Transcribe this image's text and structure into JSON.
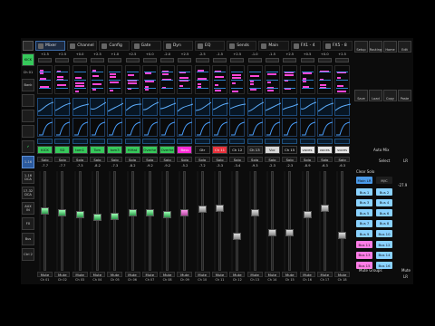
{
  "tabs": [
    {
      "label": "Mixer",
      "icon": "mixer-icon",
      "active": true
    },
    {
      "label": "Channel",
      "icon": "channel-icon"
    },
    {
      "label": "Config",
      "icon": "config-icon"
    },
    {
      "label": "Gate",
      "icon": "gate-icon"
    },
    {
      "label": "Dyn",
      "icon": "dyn-icon"
    },
    {
      "label": "EQ",
      "icon": "eq-icon"
    },
    {
      "label": "Sends",
      "icon": "sends-icon"
    },
    {
      "label": "Main",
      "icon": "main-icon"
    },
    {
      "label": "FX1 - 4",
      "icon": "fx-icon"
    },
    {
      "label": "FX5 - 8",
      "icon": "fx-icon"
    }
  ],
  "left": {
    "kick": "KICK",
    "ch": "Ch 01",
    "bank": "Bank",
    "buttons": [
      "",
      "",
      "",
      ""
    ],
    "layers": [
      "1-16",
      "1-16\nDCA",
      "17-32\nDCA",
      "AUX\nIN",
      "FX",
      "Bus",
      "Ctrl 2"
    ]
  },
  "channels": [
    {
      "name": "KICK",
      "gain": "+2.5",
      "db": "-7.7",
      "ch": "Ch 01",
      "color": "#36c95b",
      "fader": 0.62
    },
    {
      "name": "SD",
      "gain": "+2.5",
      "db": "-7.7",
      "ch": "Ch 02",
      "color": "#36c95b",
      "fader": 0.6
    },
    {
      "name": "tom1",
      "gain": "+0.0",
      "db": "-7.3",
      "ch": "Ch 03",
      "color": "#36c95b",
      "fader": 0.58
    },
    {
      "name": "Tom",
      "gain": "+2.5",
      "db": "-8.2",
      "ch": "Ch 04",
      "color": "#36c95b",
      "fader": 0.55
    },
    {
      "name": "tom3",
      "gain": "+1.0",
      "db": "-7.3",
      "ch": "Ch 05",
      "color": "#36c95b",
      "fader": 0.56
    },
    {
      "name": "HiHat",
      "gain": "+2.5",
      "db": "-8.2",
      "ch": "Ch 06",
      "color": "#36c95b",
      "fader": 0.6
    },
    {
      "name": "Overhe",
      "gain": "+0.0",
      "db": "-9.2",
      "ch": "Ch 07",
      "color": "#36c95b",
      "fader": 0.6
    },
    {
      "name": "Overhe",
      "gain": "-2.0",
      "db": "-9.2",
      "ch": "Ch 08",
      "color": "#36c95b",
      "fader": 0.58
    },
    {
      "name": "Bass",
      "gain": "+2.5",
      "db": "-5.2",
      "ch": "Ch 09",
      "color": "#ff2bd7",
      "fader": 0.6
    },
    {
      "name": "Gtr",
      "gain": "-2.5",
      "db": "-7.2",
      "ch": "Ch 10",
      "color": "#111",
      "fader": 0.64
    },
    {
      "name": "Ch 11",
      "gain": "-1.5",
      "db": "-3.3",
      "ch": "Ch 11",
      "color": "#e8323c",
      "fader": 0.65
    },
    {
      "name": "Ch 12",
      "gain": "+2.5",
      "db": "-3.4",
      "ch": "Ch 12",
      "color": "#111",
      "fader": 0.34
    },
    {
      "name": "Ch 13",
      "gain": "-1.0",
      "db": "-9.3",
      "ch": "Ch 13",
      "color": "#222",
      "fader": 0.6
    },
    {
      "name": "Voc",
      "gain": "-1.5",
      "db": "-2.3",
      "ch": "Ch 14",
      "color": "#d6d6d6",
      "fader": 0.38
    },
    {
      "name": "Ch 15",
      "gain": "+2.5",
      "db": "-2.3",
      "ch": "Ch 15",
      "color": "#111",
      "fader": 0.38
    },
    {
      "name": "voces",
      "gain": "+0.5",
      "db": "-8.9",
      "ch": "Ch 16",
      "color": "#e6e6e6",
      "fader": 0.58
    },
    {
      "name": "voces",
      "gain": "+0.0",
      "db": "-6.3",
      "ch": "Ch 17",
      "color": "#e6e6e6",
      "fader": 0.65
    },
    {
      "name": "voces",
      "gain": "+2.5",
      "db": "-6.3",
      "ch": "Ch 18",
      "color": "#e6e6e6",
      "fader": 0.35
    }
  ],
  "right": {
    "tools": [
      "Setup",
      "Routing",
      "Home",
      "Edit",
      "Save",
      "Load",
      "Copy",
      "Paste"
    ],
    "scene": "Auto Mix",
    "select": "Select",
    "lr": "LR",
    "clear": "Clear Solo",
    "main_db": "-27.9",
    "mainlr": "Main LR",
    "mc": "M/C",
    "buses": [
      {
        "label": "Bus 1",
        "color": "#8ad2ff"
      },
      {
        "label": "Bus 2",
        "color": "#8ad2ff"
      },
      {
        "label": "Bus 3",
        "color": "#8ad2ff"
      },
      {
        "label": "Bus 4",
        "color": "#8ad2ff"
      },
      {
        "label": "Bus 5",
        "color": "#8ad2ff"
      },
      {
        "label": "Bus 6",
        "color": "#8ad2ff"
      },
      {
        "label": "Bus 7",
        "color": "#8ad2ff"
      },
      {
        "label": "Bus 8",
        "color": "#8ad2ff"
      },
      {
        "label": "Bus 9",
        "color": "#8ad2ff"
      },
      {
        "label": "Bus 10",
        "color": "#8ad2ff"
      },
      {
        "label": "Bus 11",
        "color": "#ff7de7"
      },
      {
        "label": "Bus 12",
        "color": "#8ad2ff"
      },
      {
        "label": "Bus 13",
        "color": "#ff7de7"
      },
      {
        "label": "Bus 14",
        "color": "#8ad2ff"
      },
      {
        "label": "Bus 15",
        "color": "#ff7de7"
      },
      {
        "label": "Bus 16",
        "color": "#8ad2ff"
      }
    ],
    "mute_groups": "Mute Groups",
    "lr_label": "LR",
    "mute": "Mute"
  },
  "labels": {
    "solo": "Solo",
    "mute": "Mute"
  }
}
